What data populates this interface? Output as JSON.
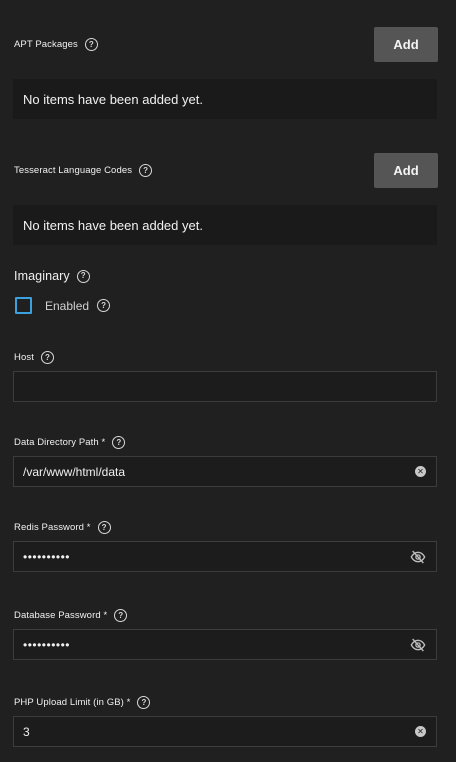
{
  "apt_packages": {
    "label": "APT Packages",
    "add_label": "Add",
    "empty_text": "No items have been added yet."
  },
  "tesseract": {
    "label": "Tesseract Language Codes",
    "add_label": "Add",
    "empty_text": "No items have been added yet."
  },
  "imaginary": {
    "label": "Imaginary",
    "enabled_label": "Enabled",
    "enabled": false
  },
  "host": {
    "label": "Host",
    "value": ""
  },
  "data_dir": {
    "label": "Data Directory Path *",
    "value": "/var/www/html/data"
  },
  "redis_password": {
    "label": "Redis Password *",
    "value": "••••••••••"
  },
  "db_password": {
    "label": "Database Password *",
    "value": "••••••••••"
  },
  "php_upload": {
    "label": "PHP Upload Limit (in GB) *",
    "value": "3"
  },
  "icons": {
    "help": "help-circle-icon",
    "clear": "clear-circle-icon",
    "visibility_off": "eye-off-icon"
  },
  "colors": {
    "background": "#202020",
    "button": "#555555",
    "checkbox_border": "#3aa0de"
  }
}
